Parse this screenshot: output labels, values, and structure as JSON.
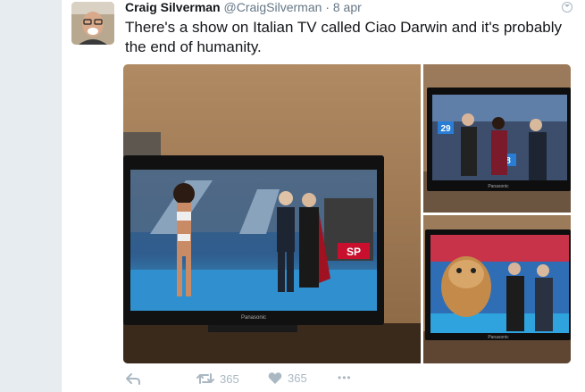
{
  "tweet": {
    "author_name": "Craig Silverman",
    "author_handle": "@CraigSilverman",
    "separator": "·",
    "timestamp": "8 apr",
    "text": "There's a show on Italian TV called Ciao Darwin and it's probably the end of humanity."
  },
  "media": {
    "main_tv_sign": "SP",
    "main_tv_brand": "Panasonic",
    "top_right_tv_brand": "Panasonic",
    "top_right_numbers": [
      "29",
      "8"
    ],
    "bottom_right_tv_brand": "Panasonic"
  },
  "actions": {
    "retweet_count": "365",
    "like_count": "365",
    "more_label": "•••"
  },
  "colors": {
    "name": "#14171a",
    "meta": "#657786",
    "action_icons": "#aab8c2",
    "page_background": "#e6ecf0"
  },
  "icons": [
    "reply-icon",
    "retweet-icon",
    "heart-icon",
    "more-icon",
    "caret-icon"
  ]
}
